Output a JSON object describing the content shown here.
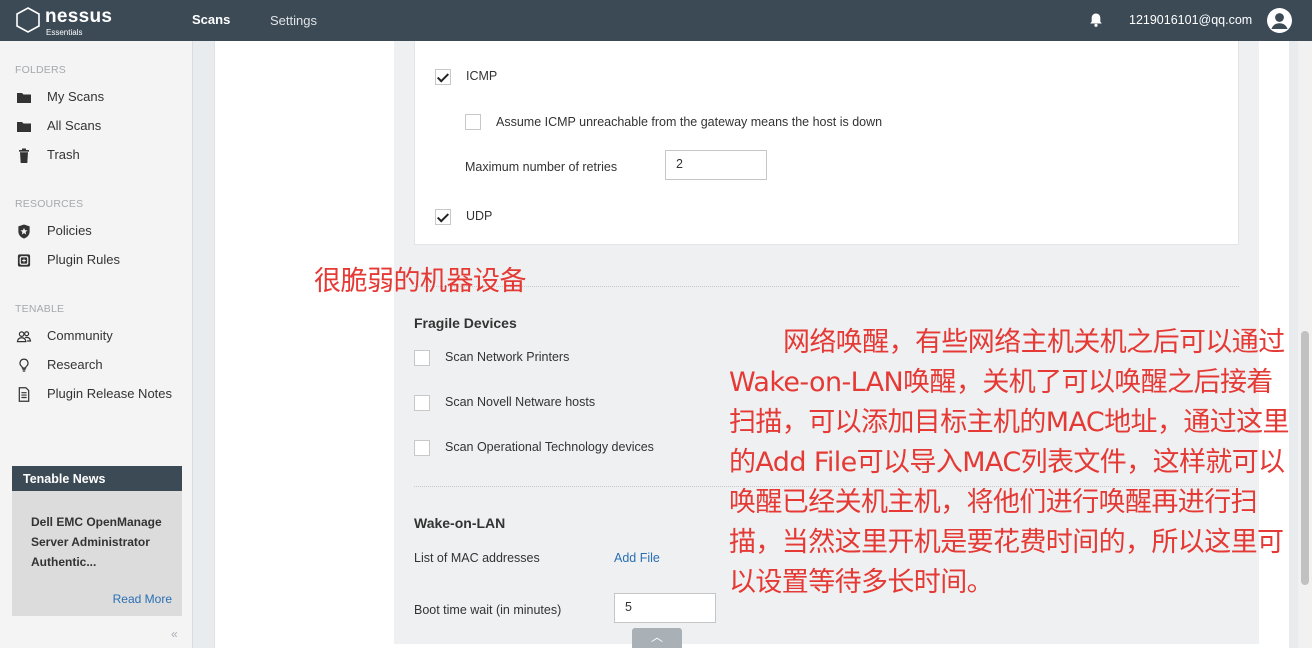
{
  "header": {
    "brand": "nessus",
    "brand_sub": "Essentials",
    "nav": {
      "scans": "Scans",
      "settings": "Settings"
    },
    "user_email": "1219016101@qq.com",
    "icons": [
      "bell-icon",
      "user-avatar-icon"
    ]
  },
  "sidebar": {
    "folders_label": "FOLDERS",
    "folders": [
      {
        "label": "My Scans",
        "icon": "folder-icon"
      },
      {
        "label": "All Scans",
        "icon": "folder-icon"
      },
      {
        "label": "Trash",
        "icon": "trash-icon"
      }
    ],
    "resources_label": "RESOURCES",
    "resources": [
      {
        "label": "Policies",
        "icon": "shield-star-icon"
      },
      {
        "label": "Plugin Rules",
        "icon": "plugin-rules-icon"
      }
    ],
    "tenable_label": "TENABLE",
    "tenable": [
      {
        "label": "Community",
        "icon": "community-icon"
      },
      {
        "label": "Research",
        "icon": "lightbulb-icon"
      },
      {
        "label": "Plugin Release Notes",
        "icon": "document-icon"
      }
    ],
    "news": {
      "title": "Tenable News",
      "article": "Dell EMC OpenManage Server Administrator Authentic...",
      "read_more": "Read More"
    },
    "collapse_glyph": "«"
  },
  "settings": {
    "icmp": {
      "label": "ICMP",
      "checked": true
    },
    "assume_icmp": {
      "label": "Assume ICMP unreachable from the gateway means the host is down",
      "checked": false
    },
    "max_retries": {
      "label": "Maximum number of retries",
      "value": "2"
    },
    "udp": {
      "label": "UDP",
      "checked": true
    },
    "fragile": {
      "heading": "Fragile Devices",
      "options": [
        {
          "label": "Scan Network Printers",
          "checked": false
        },
        {
          "label": "Scan Novell Netware hosts",
          "checked": false
        },
        {
          "label": "Scan Operational Technology devices",
          "checked": false
        }
      ]
    },
    "wol": {
      "heading": "Wake-on-LAN",
      "mac_label": "List of MAC addresses",
      "add_file": "Add File",
      "boot_wait_label": "Boot time wait (in minutes)",
      "boot_wait_value": "5"
    },
    "scroll_up_glyph": "︿"
  },
  "annotations": {
    "fragile_note": "很脆弱的机器设备",
    "wol_note": "网络唤醒，有些网络主机关机之后可以通过Wake-on-LAN唤醒，关机了可以唤醒之后接着扫描，可以添加目标主机的MAC地址，通过这里的Add File可以导入MAC列表文件，这样就可以唤醒已经关机主机，将他们进行唤醒再进行扫描，当然这里开机是要花费时间的，所以这里可以设置等待多长时间。"
  },
  "colors": {
    "topbar": "#3c4a56",
    "link": "#2a6fb3",
    "annotation": "#e53935"
  }
}
